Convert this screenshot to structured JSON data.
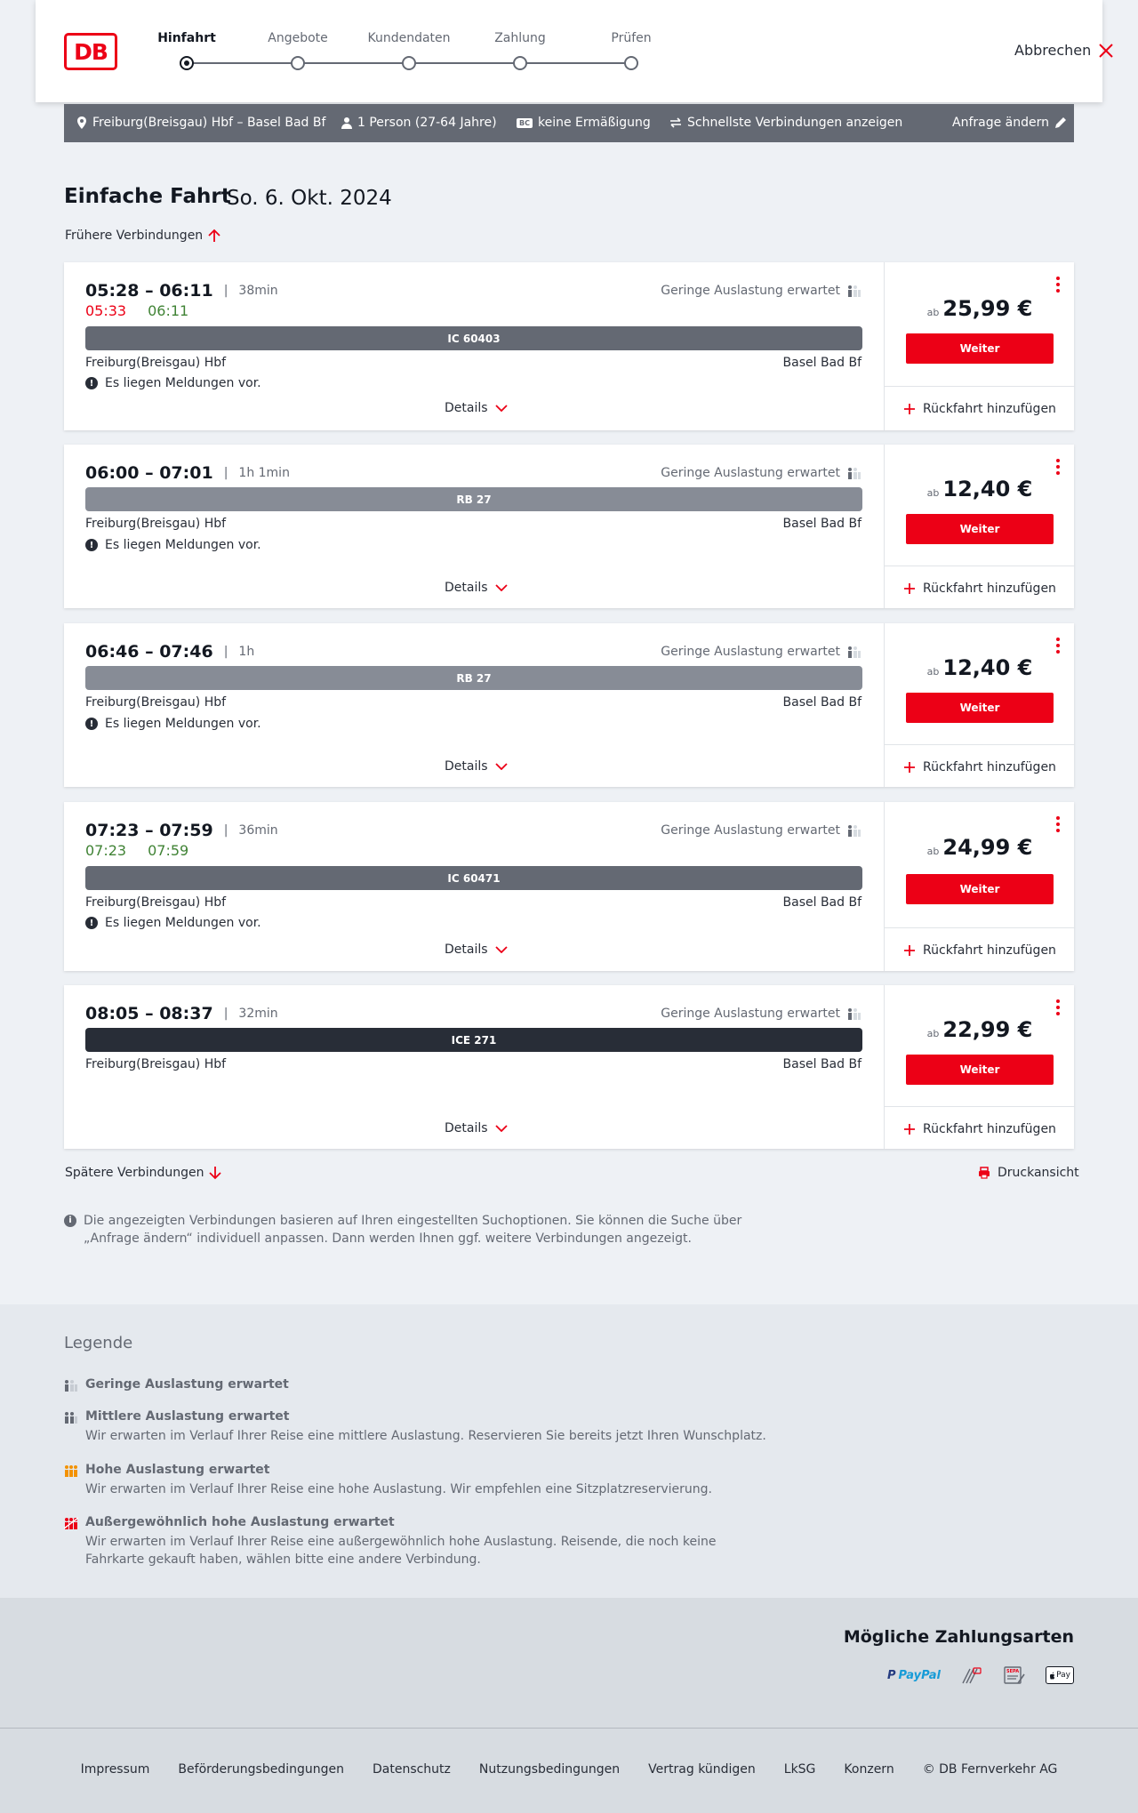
{
  "header": {
    "logo": "DB",
    "steps": [
      {
        "label": "Hinfahrt",
        "active": true
      },
      {
        "label": "Angebote",
        "active": false
      },
      {
        "label": "Kundendaten",
        "active": false
      },
      {
        "label": "Zahlung",
        "active": false
      },
      {
        "label": "Prüfen",
        "active": false
      }
    ],
    "cancel_label": "Abbrechen"
  },
  "filter": {
    "route": "Freiburg(Breisgau) Hbf – Basel Bad Bf",
    "passengers": "1 Person (27-64 Jahre)",
    "discount_badge": "BC",
    "discount": "keine Ermäßigung",
    "option": "Schnellste Verbindungen anzeigen",
    "edit_label": "Anfrage ändern"
  },
  "main": {
    "title": "Einfache Fahrt",
    "date": "So. 6. Okt. 2024",
    "earlier_label": "Frühere Verbindungen",
    "later_label": "Spätere Verbindungen",
    "print_label": "Druckansicht",
    "info_text": "Die angezeigten Verbindungen basieren auf Ihren eingestellten Suchoptionen. Sie können die Suche über „Anfrage ändern“ individuell anpassen. Dann werden Ihnen ggf. weitere Verbindungen angezeigt."
  },
  "connections": [
    {
      "times": "05:28 – 06:11",
      "duration": "38min",
      "rt_dep": "05:33",
      "rt_arr": "06:11",
      "rt_dep_color": "#ec0016",
      "rt_arr_color": "#408335",
      "occupancy": "Geringe Auslastung erwartet",
      "train": "IC 60403",
      "train_color": "#646973",
      "from": "Freiburg(Breisgau) Hbf",
      "to": "Basel Bad Bf",
      "message": "Es liegen Meldungen vor.",
      "details": "Details",
      "price_prefix": "ab",
      "price": "25,99 €",
      "button": "Weiter",
      "return_label": "Rückfahrt hinzufügen"
    },
    {
      "times": "06:00 – 07:01",
      "duration": "1h 1min",
      "occupancy": "Geringe Auslastung erwartet",
      "train": "RB 27",
      "train_color": "#878c96",
      "from": "Freiburg(Breisgau) Hbf",
      "to": "Basel Bad Bf",
      "message": "Es liegen Meldungen vor.",
      "details": "Details",
      "price_prefix": "ab",
      "price": "12,40 €",
      "button": "Weiter",
      "return_label": "Rückfahrt hinzufügen"
    },
    {
      "times": "06:46 – 07:46",
      "duration": "1h",
      "occupancy": "Geringe Auslastung erwartet",
      "train": "RB 27",
      "train_color": "#878c96",
      "from": "Freiburg(Breisgau) Hbf",
      "to": "Basel Bad Bf",
      "message": "Es liegen Meldungen vor.",
      "details": "Details",
      "price_prefix": "ab",
      "price": "12,40 €",
      "button": "Weiter",
      "return_label": "Rückfahrt hinzufügen"
    },
    {
      "times": "07:23 – 07:59",
      "duration": "36min",
      "rt_dep": "07:23",
      "rt_arr": "07:59",
      "rt_dep_color": "#408335",
      "rt_arr_color": "#408335",
      "occupancy": "Geringe Auslastung erwartet",
      "train": "IC 60471",
      "train_color": "#646973",
      "from": "Freiburg(Breisgau) Hbf",
      "to": "Basel Bad Bf",
      "message": "Es liegen Meldungen vor.",
      "details": "Details",
      "price_prefix": "ab",
      "price": "24,99 €",
      "button": "Weiter",
      "return_label": "Rückfahrt hinzufügen"
    },
    {
      "times": "08:05 – 08:37",
      "duration": "32min",
      "occupancy": "Geringe Auslastung erwartet",
      "train": "ICE 271",
      "train_color": "#282d37",
      "from": "Freiburg(Breisgau) Hbf",
      "to": "Basel Bad Bf",
      "details": "Details",
      "price_prefix": "ab",
      "price": "22,99 €",
      "button": "Weiter",
      "return_label": "Rückfahrt hinzufügen"
    }
  ],
  "legend": {
    "title": "Legende",
    "items": [
      {
        "title": "Geringe Auslastung erwartet",
        "text": ""
      },
      {
        "title": "Mittlere Auslastung erwartet",
        "text": "Wir erwarten im Verlauf Ihrer Reise eine mittlere Auslastung. Reservieren Sie bereits jetzt Ihren Wunschplatz."
      },
      {
        "title": "Hohe Auslastung erwartet",
        "text": "Wir erwarten im Verlauf Ihrer Reise eine hohe Auslastung. Wir empfehlen eine Sitzplatzreservierung."
      },
      {
        "title": "Außergewöhnlich hohe Auslastung erwartet",
        "text": "Wir erwarten im Verlauf Ihrer Reise eine außergewöhnlich hohe Auslastung. Reisende, die noch keine Fahrkarte gekauft haben, wählen bitte eine andere Verbindung."
      }
    ]
  },
  "payment": {
    "title": "Mögliche Zahlungsarten",
    "paypal": "PayPal",
    "sepa": "SEPA",
    "applepay": "Pay"
  },
  "footer": {
    "links": [
      "Impressum",
      "Beförderungsbedingungen",
      "Datenschutz",
      "Nutzungsbedingungen",
      "Vertrag kündigen",
      "LkSG",
      "Konzern",
      "© DB Fernverkehr AG"
    ]
  },
  "colors": {
    "accent": "#ec0016",
    "filter_bg": "#646973",
    "on_time": "#408335"
  }
}
